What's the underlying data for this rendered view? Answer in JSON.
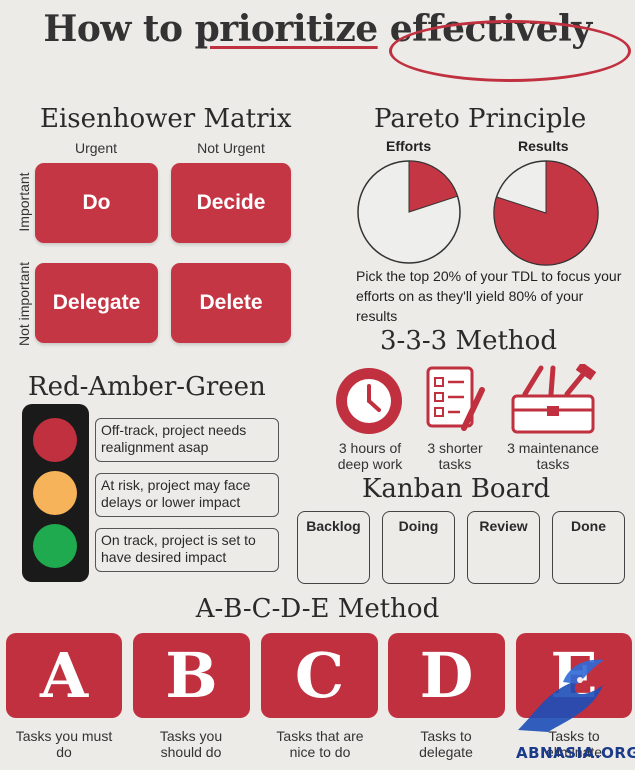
{
  "title": {
    "part1": "How to ",
    "part2": "prioritize",
    "part3": "effectively"
  },
  "eisenhower": {
    "heading": "Eisenhower Matrix",
    "col_urgent": "Urgent",
    "col_not_urgent": "Not Urgent",
    "row_important": "Important",
    "row_not_important": "Not important",
    "cells": [
      "Do",
      "Decide",
      "Delegate",
      "Delete"
    ]
  },
  "pareto": {
    "heading": "Pareto Principle",
    "efforts_label": "Efforts",
    "results_label": "Results",
    "efforts_fraction": 0.2,
    "results_fraction": 0.8,
    "description": "Pick the top 20% of your TDL to focus your efforts on as they'll yield 80% of your results"
  },
  "method333": {
    "heading": "3-3-3 Method",
    "items": [
      "3 hours of deep work",
      "3 shorter tasks",
      "3 maintenance tasks"
    ]
  },
  "rag": {
    "heading": "Red-Amber-Green",
    "items": [
      "Off-track, project needs realignment asap",
      "At risk, project may face delays or lower impact",
      "On track, project is set to have desired impact"
    ],
    "colors": [
      "#c0303f",
      "#f7b35a",
      "#1faa4f"
    ]
  },
  "kanban": {
    "heading": "Kanban Board",
    "columns": [
      "Backlog",
      "Doing",
      "Review",
      "Done"
    ]
  },
  "abcde": {
    "heading": "A-B-C-D-E Method",
    "letters": [
      "A",
      "B",
      "C",
      "D",
      "E"
    ],
    "captions": [
      "Tasks you must do",
      "Tasks you should do",
      "Tasks that are nice to do",
      "Tasks to delegate",
      "Tasks to eliminate"
    ]
  },
  "watermark": "ABNASIA.ORG",
  "accent_color": "#c0303f"
}
